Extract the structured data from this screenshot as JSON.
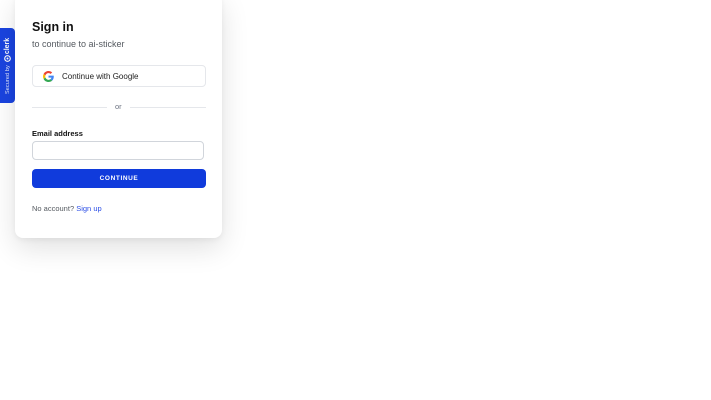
{
  "badge": {
    "secured_text": "Secured by",
    "brand_name": "clerk",
    "brand_icon": "clerk-logo-icon",
    "color": "#1a44e0"
  },
  "signin": {
    "title": "Sign in",
    "subtitle": "to continue to ai-sticker",
    "google_button_label": "Continue with Google",
    "google_icon": "google-icon",
    "divider_text": "or",
    "email_label": "Email address",
    "email_value": "",
    "email_placeholder": "",
    "continue_label": "CONTINUE",
    "no_account_text": "No account?",
    "signup_link": "Sign up"
  },
  "colors": {
    "primary": "#103bdc",
    "link": "#2b4ee6"
  }
}
